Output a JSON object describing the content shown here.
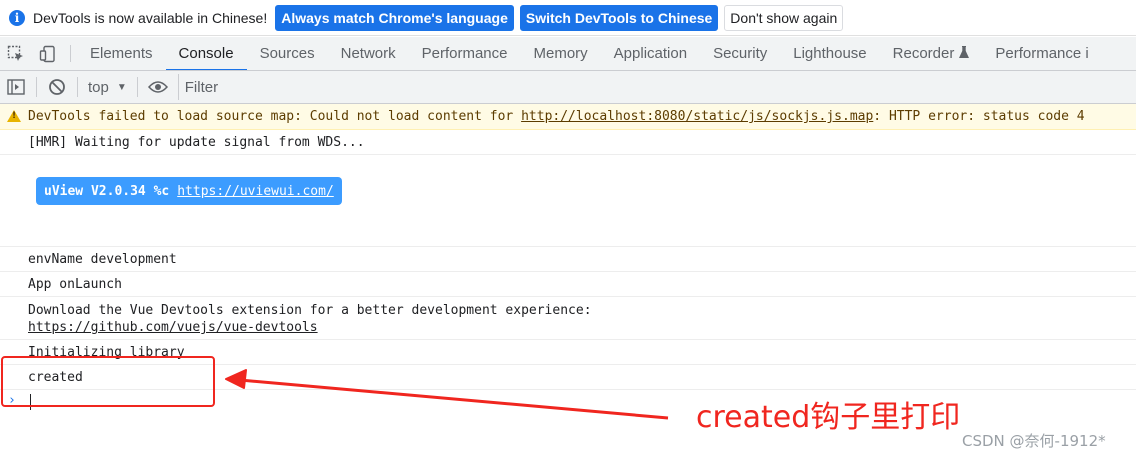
{
  "infobar": {
    "message": "DevTools is now available in Chinese!",
    "btn_match": "Always match Chrome's language",
    "btn_switch": "Switch DevTools to Chinese",
    "btn_dismiss": "Don't show again"
  },
  "tabs": {
    "items": [
      {
        "label": "Elements"
      },
      {
        "label": "Console"
      },
      {
        "label": "Sources"
      },
      {
        "label": "Network"
      },
      {
        "label": "Performance"
      },
      {
        "label": "Memory"
      },
      {
        "label": "Application"
      },
      {
        "label": "Security"
      },
      {
        "label": "Lighthouse"
      },
      {
        "label": "Recorder"
      },
      {
        "label": "Performance i"
      }
    ],
    "active": "Console"
  },
  "toolbar": {
    "context": "top",
    "filter_placeholder": "Filter"
  },
  "console": {
    "warning": {
      "prefix": "DevTools failed to load source map: Could not load content for ",
      "url": "http://localhost:8080/static/js/sockjs.js.map",
      "suffix": ": HTTP error: status code 4"
    },
    "hmr": "[HMR] Waiting for update signal from WDS...",
    "uview": {
      "label": "uView V2.0.34 %c",
      "url": "https://uviewui.com/"
    },
    "env": "envName development",
    "launch": "App onLaunch",
    "vue_devtools": {
      "line1": "Download the Vue Devtools extension for a better development experience:",
      "url": "https://github.com/vuejs/vue-devtools"
    },
    "init": "Initializing library",
    "created": "created"
  },
  "annotation": {
    "text": "created钩子里打印"
  },
  "watermark": "CSDN @奈何-1912*",
  "colors": {
    "accent": "#1a73e8",
    "warning_bg": "#fffbe5",
    "badge": "#3c9cff",
    "annotation": "#f0261f"
  }
}
